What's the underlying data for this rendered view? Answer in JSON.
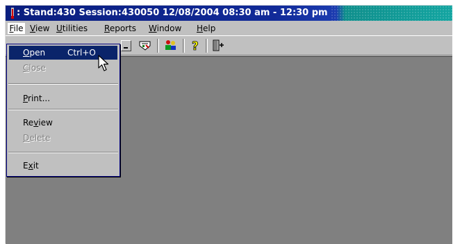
{
  "window": {
    "title": ": Stand:430 Session:430050 12/08/2004 08:30 am - 12:30 pm",
    "icon": "thermometer-icon"
  },
  "menubar": {
    "items": [
      {
        "pre": "",
        "mn": "F",
        "post": "ile"
      },
      {
        "pre": "",
        "mn": "V",
        "post": "iew"
      },
      {
        "pre": "",
        "mn": "U",
        "post": "tilities"
      },
      {
        "pre": "",
        "mn": "R",
        "post": "eports"
      },
      {
        "pre": "",
        "mn": "W",
        "post": "indow"
      },
      {
        "pre": "",
        "mn": "H",
        "post": "elp"
      }
    ]
  },
  "toolbar": {
    "icons": [
      "minimize-icon",
      "report-edit-icon",
      "people-icon",
      "help-question-icon",
      "exit-door-icon"
    ]
  },
  "file_menu": {
    "items": [
      {
        "pre": "",
        "mn": "O",
        "post": "pen",
        "shortcut": "Ctrl+O",
        "state": "selected"
      },
      {
        "pre": "",
        "mn": "C",
        "post": "lose",
        "shortcut": "",
        "state": "disabled"
      },
      {
        "pre": "",
        "mn": "P",
        "post": "rint...",
        "shortcut": "",
        "state": "enabled"
      },
      {
        "pre": "Re",
        "mn": "v",
        "post": "iew",
        "shortcut": "",
        "state": "enabled"
      },
      {
        "pre": "",
        "mn": "D",
        "post": "elete",
        "shortcut": "",
        "state": "disabled"
      },
      {
        "pre": "E",
        "mn": "x",
        "post": "it",
        "shortcut": "",
        "state": "enabled"
      }
    ]
  },
  "colors": {
    "title_bar": "#0a1e7e",
    "menu_highlight": "#0a246a",
    "workspace": "#808080",
    "face": "#c0c0c0"
  }
}
